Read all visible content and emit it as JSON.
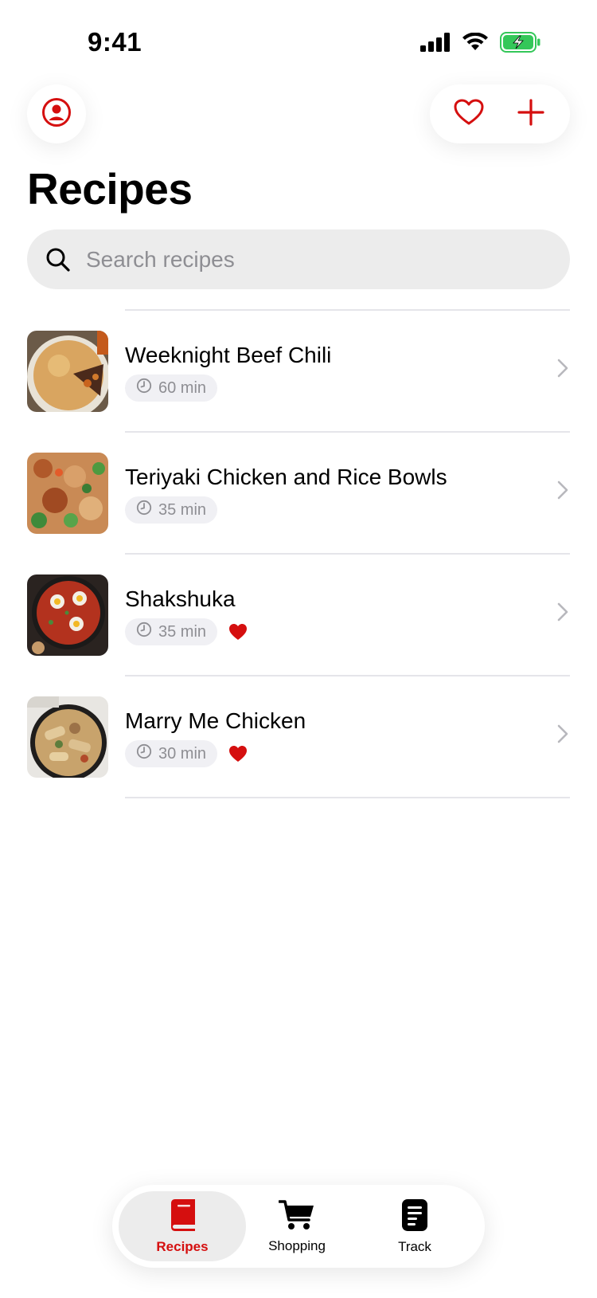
{
  "status_bar": {
    "time": "9:41",
    "icons": [
      "cellular-signal-icon",
      "wifi-icon",
      "battery-charging-icon"
    ]
  },
  "header": {
    "profile_icon": "profile-icon",
    "favorites_icon": "heart-outline-icon",
    "add_icon": "plus-icon",
    "title": "Recipes"
  },
  "search": {
    "placeholder": "Search recipes",
    "value": ""
  },
  "recipes": [
    {
      "name": "Weeknight Beef Chili",
      "time": "60 min",
      "favorite": false,
      "thumbnail": "beef-chili-photo"
    },
    {
      "name": "Teriyaki Chicken and Rice Bowls",
      "time": "35 min",
      "favorite": false,
      "thumbnail": "teriyaki-bowl-photo"
    },
    {
      "name": "Shakshuka",
      "time": "35 min",
      "favorite": true,
      "thumbnail": "shakshuka-photo"
    },
    {
      "name": "Marry Me Chicken",
      "time": "30 min",
      "favorite": true,
      "thumbnail": "marry-me-chicken-photo"
    }
  ],
  "tabs": [
    {
      "label": "Recipes",
      "icon": "book-icon",
      "active": true
    },
    {
      "label": "Shopping",
      "icon": "cart-icon",
      "active": false
    },
    {
      "label": "Track",
      "icon": "document-icon",
      "active": false
    }
  ],
  "colors": {
    "accent": "#d50f0f",
    "secondary_text": "#8e8e93",
    "search_bg": "#ececec",
    "badge_bg": "#f0f0f4",
    "battery_green": "#34c759"
  }
}
